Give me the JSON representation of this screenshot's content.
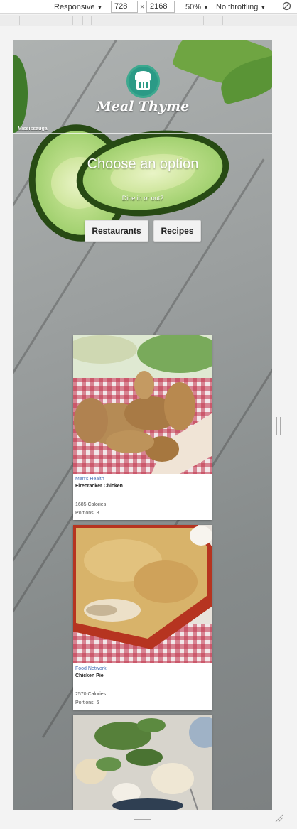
{
  "devtools": {
    "device": "Responsive",
    "width": "728",
    "times": "×",
    "height": "2168",
    "zoom": "50%",
    "throttling": "No throttling"
  },
  "header": {
    "brand": "Meal Thyme",
    "city": "Mississauga"
  },
  "hero": {
    "title": "Choose an option",
    "subtitle": "Dine in or out?",
    "buttons": {
      "restaurants": "Restaurants",
      "recipes": "Recipes"
    }
  },
  "recipes": [
    {
      "source": "Men's Health",
      "name": "Firecracker Chicken",
      "calories": "1685 Calories",
      "portions": "Portions: 8"
    },
    {
      "source": "Food Network",
      "name": "Chicken Pie",
      "calories": "2570 Calories",
      "portions": "Portions: 6"
    }
  ],
  "colors": {
    "brand_teal": "#2b9a86",
    "source_link": "#4b73b8"
  }
}
